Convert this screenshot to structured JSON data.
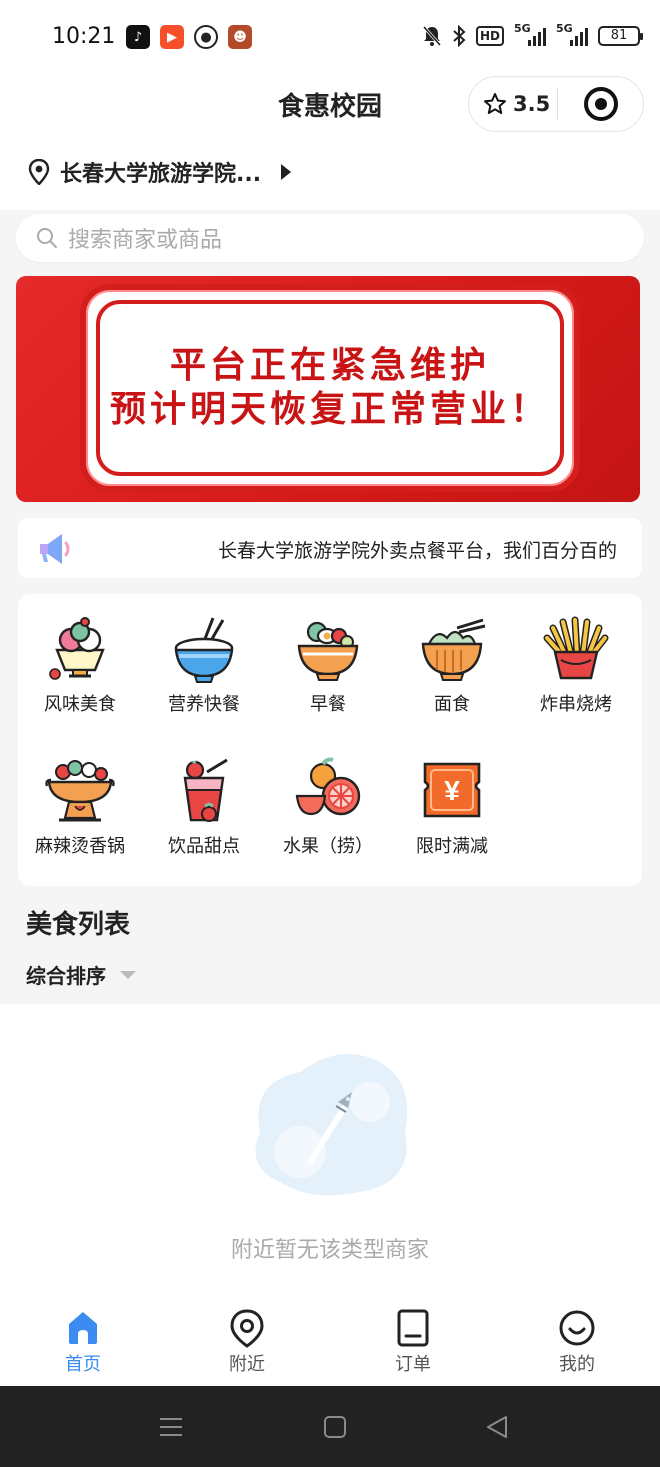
{
  "status_bar": {
    "time": "10:21",
    "battery": "81",
    "network_label": "5G",
    "hd_label": "HD"
  },
  "header": {
    "title": "食惠校园",
    "rating": "3.5",
    "location": "长春大学旅游学院..."
  },
  "search": {
    "placeholder": "搜索商家或商品"
  },
  "banner": {
    "line1": "平台正在紧急维护",
    "line2": "预计明天恢复正常营业！"
  },
  "notice": {
    "text": "长春大学旅游学院外卖点餐平台，我们百分百的"
  },
  "categories": [
    {
      "label": "风味美食",
      "icon": "sundae-icon"
    },
    {
      "label": "营养快餐",
      "icon": "rice-bowl-icon"
    },
    {
      "label": "早餐",
      "icon": "breakfast-bowl-icon"
    },
    {
      "label": "面食",
      "icon": "noodle-bowl-icon"
    },
    {
      "label": "炸串烧烤",
      "icon": "fries-icon"
    },
    {
      "label": "麻辣烫香锅",
      "icon": "hot-pot-icon"
    },
    {
      "label": "饮品甜点",
      "icon": "juice-icon"
    },
    {
      "label": "水果（捞）",
      "icon": "fruit-icon"
    },
    {
      "label": "限时满减",
      "icon": "yuan-coupon-icon"
    }
  ],
  "list": {
    "title": "美食列表",
    "sort_label": "综合排序",
    "empty_text": "附近暂无该类型商家"
  },
  "tabs": [
    {
      "label": "首页",
      "active": true
    },
    {
      "label": "附近",
      "active": false
    },
    {
      "label": "订单",
      "active": false
    },
    {
      "label": "我的",
      "active": false
    }
  ],
  "colors": {
    "accent": "#3a8cf0",
    "banner_red": "#d91c1c"
  }
}
